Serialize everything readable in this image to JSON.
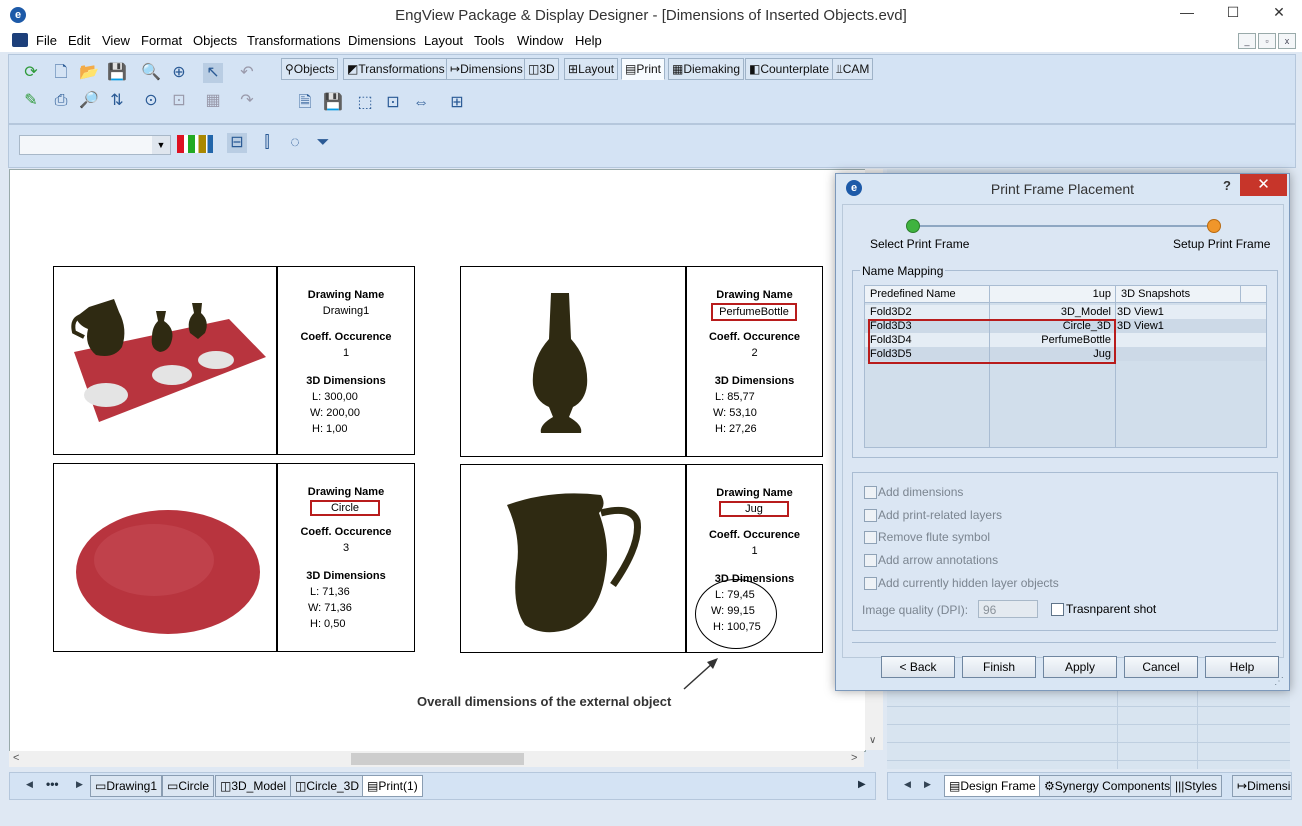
{
  "app": {
    "title": "EngView Package & Display Designer - [Dimensions of Inserted Objects.evd]",
    "logo": "e"
  },
  "window_controls": {
    "minimize": "—",
    "maximize": "☐",
    "close": "✕"
  },
  "menu": [
    "File",
    "Edit",
    "View",
    "Format",
    "Objects",
    "Transformations",
    "Dimensions",
    "Layout",
    "Tools",
    "Window",
    "Help"
  ],
  "toolbar_tabs": [
    {
      "label": "Objects",
      "icon": "objects-icon"
    },
    {
      "label": "Transformations",
      "icon": "transformations-icon"
    },
    {
      "label": "Dimensions",
      "icon": "dimensions-icon"
    },
    {
      "label": "3D",
      "icon": "3d-icon"
    },
    {
      "label": "Layout",
      "icon": "layout-icon"
    },
    {
      "label": "Print",
      "icon": "print-icon"
    },
    {
      "label": "Diemaking",
      "icon": "diemaking-icon"
    },
    {
      "label": "Counterplate",
      "icon": "counterplate-icon"
    },
    {
      "label": "CAM",
      "icon": "cam-icon"
    }
  ],
  "frames": [
    {
      "name_label": "Drawing Name",
      "name": "Drawing1",
      "coeff_label": "Coeff. Occurence",
      "coeff": "1",
      "dims_label": "3D Dimensions",
      "L": "L: 300,00",
      "W": "W: 200,00",
      "H": "H: 1,00"
    },
    {
      "name_label": "Drawing Name",
      "name": "PerfumeBottle",
      "coeff_label": "Coeff. Occurence",
      "coeff": "2",
      "dims_label": "3D Dimensions",
      "L": "L: 85,77",
      "W": "W: 53,10",
      "H": "H: 27,26"
    },
    {
      "name_label": "Drawing Name",
      "name": "Circle",
      "coeff_label": "Coeff. Occurence",
      "coeff": "3",
      "dims_label": "3D Dimensions",
      "L": "L: 71,36",
      "W": "W: 71,36",
      "H": "H: 0,50"
    },
    {
      "name_label": "Drawing Name",
      "name": "Jug",
      "coeff_label": "Coeff. Occurence",
      "coeff": "1",
      "dims_label": "3D Dimensions",
      "L": "L: 79,45",
      "W": "W: 99,15",
      "H": "H: 100,75"
    }
  ],
  "annotation": "Overall dimensions of the external object",
  "colors": {
    "accent_red": "#b81c1c",
    "toolbar_bg": "#d4e3f4",
    "wood_dark": "#2f2a12",
    "mat_red": "#b8343e"
  },
  "bottom_tabs": [
    "Drawing1",
    "Circle",
    "3D_Model",
    "Circle_3D",
    "Print(1)"
  ],
  "bottom_tabs_more": "•••",
  "right_tabs": [
    "Design Frame",
    "Synergy Components",
    "Styles",
    "Dimensi"
  ],
  "dialog": {
    "title": "Print Frame Placement",
    "help": "?",
    "close": "✕",
    "step1": "Select Print Frame",
    "step2": "Setup Print Frame",
    "group_label": "Name Mapping",
    "columns": [
      "Predefined Name",
      "1up",
      "3D Snapshots"
    ],
    "rows": [
      [
        "Fold3D2",
        "3D_Model",
        "3D View1"
      ],
      [
        "Fold3D3",
        "Circle_3D",
        "3D View1"
      ],
      [
        "Fold3D4",
        "PerfumeBottle",
        ""
      ],
      [
        "Fold3D5",
        "Jug",
        ""
      ]
    ],
    "options": [
      "Add dimensions",
      "Add print-related layers",
      "Remove flute symbol",
      "Add arrow annotations",
      "Add currently hidden layer objects"
    ],
    "quality_label": "Image quality (DPI):",
    "quality_value": "96",
    "transparent": "Trasnparent shot",
    "buttons": [
      "< Back",
      "Finish",
      "Apply",
      "Cancel",
      "Help"
    ]
  }
}
